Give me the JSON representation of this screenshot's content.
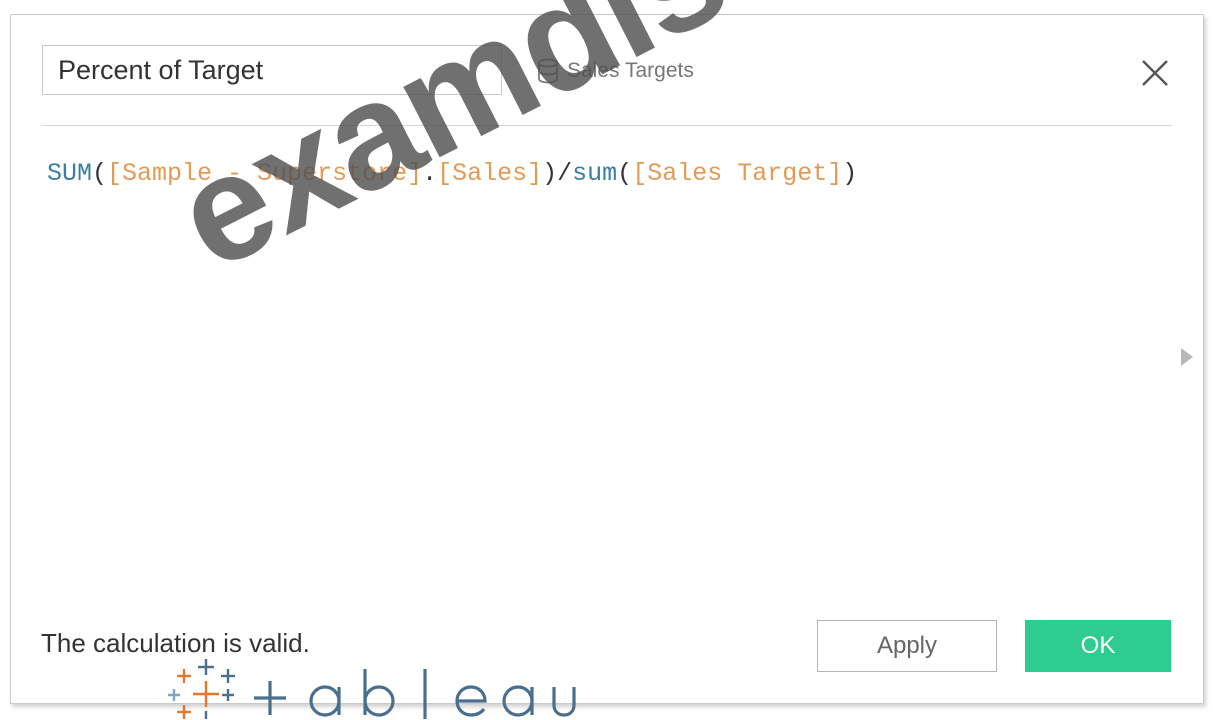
{
  "calc_name": "Percent of Target",
  "datasource": {
    "label": "Sales Targets",
    "icon": "database-icon"
  },
  "formula": {
    "tokens": [
      {
        "text": "SUM",
        "kind": "fn"
      },
      {
        "text": "(",
        "kind": "punct"
      },
      {
        "text": "[Sample - Superstore]",
        "kind": "field"
      },
      {
        "text": ".",
        "kind": "punct"
      },
      {
        "text": "[Sales]",
        "kind": "field"
      },
      {
        "text": ")/",
        "kind": "punct"
      },
      {
        "text": "sum",
        "kind": "fn"
      },
      {
        "text": "(",
        "kind": "punct"
      },
      {
        "text": "[Sales Target]",
        "kind": "field"
      },
      {
        "text": ")",
        "kind": "punct"
      }
    ]
  },
  "status": "The calculation is valid.",
  "buttons": {
    "apply": "Apply",
    "ok": "OK"
  },
  "icons": {
    "close": "close-icon",
    "expand": "chevron-right-icon"
  },
  "watermark": "examdisc",
  "logo": {
    "text": "tableau"
  },
  "colors": {
    "function": "#3b7fa0",
    "field": "#e39a54",
    "ok_button": "#2ecc8f",
    "logo_blue": "#4a6e8e",
    "logo_orange": "#e8762c"
  }
}
